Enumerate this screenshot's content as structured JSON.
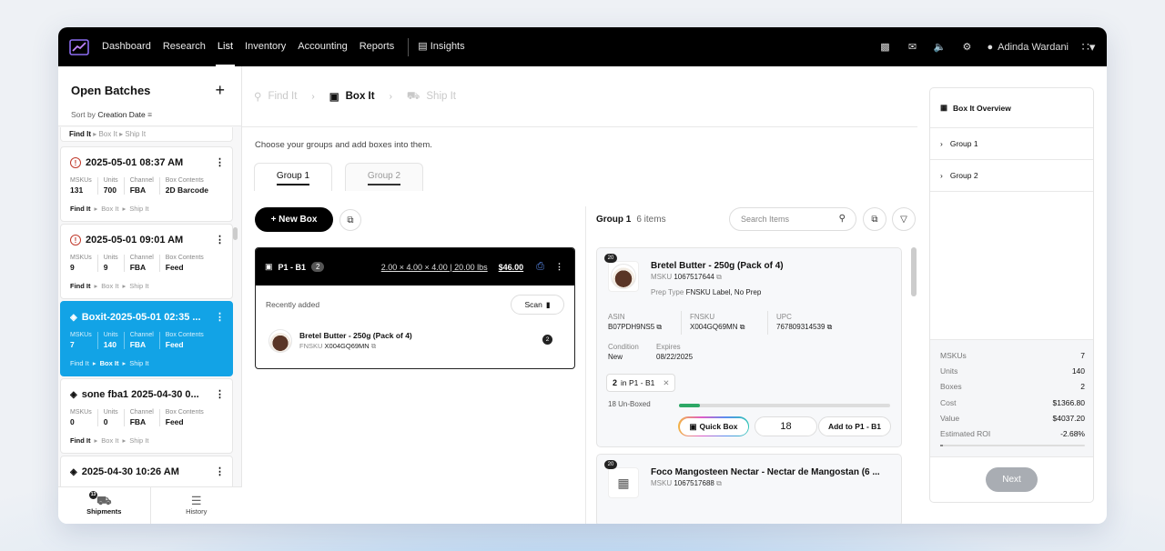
{
  "nav": {
    "items": [
      "Dashboard",
      "Research",
      "List",
      "Inventory",
      "Accounting",
      "Reports"
    ],
    "active": "List",
    "insights": "Insights",
    "user": "Adinda Wardani"
  },
  "sidebar": {
    "title": "Open Batches",
    "sort_label": "Sort by",
    "sort_value": "Creation Date",
    "fragment_steps": [
      "Find It",
      "Box It",
      "Ship It"
    ],
    "batches": [
      {
        "title": "2025-05-01 08:37 AM",
        "status": "alert",
        "mskus": "131",
        "units": "700",
        "channel": "FBA",
        "box_contents": "2D Barcode",
        "steps": [
          "Find It",
          "Box It",
          "Ship It"
        ],
        "active_step": "Find It"
      },
      {
        "title": "2025-05-01 09:01 AM",
        "status": "alert",
        "mskus": "9",
        "units": "9",
        "channel": "FBA",
        "box_contents": "Feed",
        "steps": [
          "Find It",
          "Box It",
          "Ship It"
        ],
        "active_step": "Find It"
      },
      {
        "title": "Boxit-2025-05-01 02:35 ...",
        "status": "stack",
        "mskus": "7",
        "units": "140",
        "channel": "FBA",
        "box_contents": "Feed",
        "steps": [
          "Find It",
          "Box It",
          "Ship It"
        ],
        "active_step": "Box It"
      },
      {
        "title": "sone fba1 2025-04-30 0...",
        "status": "stack",
        "mskus": "0",
        "units": "0",
        "channel": "FBA",
        "box_contents": "Feed",
        "steps": [
          "Find It",
          "Box It",
          "Ship It"
        ],
        "active_step": "Find It"
      },
      {
        "title": "2025-04-30 10:26 AM",
        "status": "stack"
      }
    ],
    "stat_labels": {
      "mskus": "MSKUs",
      "units": "Units",
      "channel": "Channel",
      "box_contents": "Box Contents"
    },
    "footer": {
      "shipments": "Shipments",
      "shipments_badge": "13",
      "history": "History"
    }
  },
  "steps": {
    "find": "Find It",
    "box": "Box It",
    "ship": "Ship It"
  },
  "main": {
    "subtitle": "Choose your groups and add boxes into them.",
    "tabs": [
      "Group 1",
      "Group 2"
    ],
    "new_box": "+ New Box",
    "box": {
      "name": "P1 - B1",
      "count": "2",
      "dims": "2.00 × 4.00 × 4.00 | 20.00 lbs",
      "price": "$46.00",
      "recent": "Recently added",
      "scan": "Scan",
      "item": {
        "name": "Bretel Butter - 250g (Pack of 4)",
        "fnsku_label": "FNSKU",
        "fnsku": "X004GQ69MN",
        "qty": "2"
      }
    },
    "group_title": "Group 1",
    "group_count": "6 items",
    "search_placeholder": "Search Items",
    "item": {
      "badge": "20",
      "name": "Bretel Butter - 250g (Pack of 4)",
      "msku_label": "MSKU",
      "msku": "1067517644",
      "prep_label": "Prep Type",
      "prep": "FNSKU Label, No Prep",
      "asin_label": "ASIN",
      "asin": "B07PDH9NS5",
      "fnsku_label": "FNSKU",
      "fnsku": "X004GQ69MN",
      "upc_label": "UPC",
      "upc": "767809314539",
      "condition_label": "Condition",
      "condition": "New",
      "expires_label": "Expires",
      "expires": "08/22/2025",
      "chip_count": "2",
      "chip_in": "in P1 - B1",
      "unboxed": "18 Un-Boxed",
      "progress": 0.1,
      "quick_box": "Quick Box",
      "qty": "18",
      "add_to": "Add to P1 - B1"
    },
    "item2": {
      "badge": "20",
      "name": "Foco Mangosteen Nectar - Nectar de Mangostan (6 ...",
      "msku_label": "MSKU",
      "msku": "1067517688"
    }
  },
  "overview": {
    "title": "Box It Overview",
    "groups": [
      "Group 1",
      "Group 2"
    ],
    "summary": [
      {
        "k": "MSKUs",
        "v": "7"
      },
      {
        "k": "Units",
        "v": "140"
      },
      {
        "k": "Boxes",
        "v": "2"
      },
      {
        "k": "Cost",
        "v": "$1366.80"
      },
      {
        "k": "Value",
        "v": "$4037.20"
      },
      {
        "k": "Estimated ROI",
        "v": "-2.68%"
      }
    ],
    "next": "Next"
  },
  "colors": {
    "accent": "#12a3e6",
    "progress": "#2ea866",
    "alert": "#c0392b"
  }
}
